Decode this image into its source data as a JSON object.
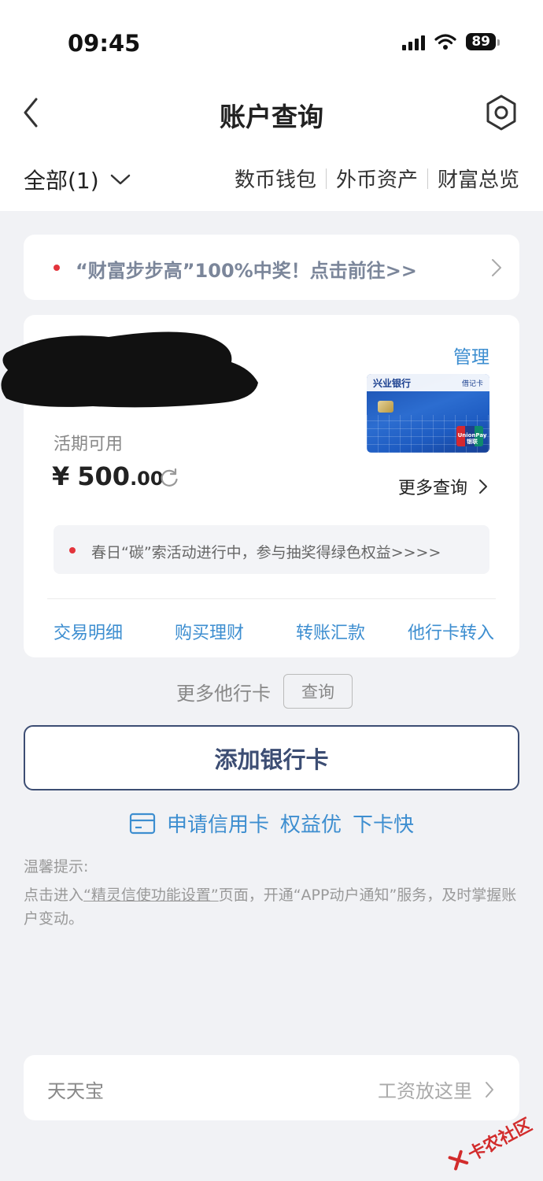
{
  "status_bar": {
    "time": "09:45",
    "battery": "89"
  },
  "nav": {
    "title": "账户查询"
  },
  "filter": {
    "all_label": "全部(1)",
    "links": [
      "数币钱包",
      "外币资产",
      "财富总览"
    ]
  },
  "banner": {
    "text": "“财富步步高”100%中奖！点击前往>>"
  },
  "account": {
    "manage_label": "管理",
    "bank_card": {
      "bank_name": "兴业银行",
      "card_type": "借记卡",
      "unionpay": "UnionPay 银联"
    },
    "available_label": "活期可用",
    "currency_symbol": "¥",
    "amount_int": "500",
    "amount_dec": ".00",
    "more_query_label": "更多查询",
    "notice": "春日“碳”索活动进行中，参与抽奖得绿色权益>>>>",
    "actions": [
      "交易明细",
      "购买理财",
      "转账汇款",
      "他行卡转入"
    ]
  },
  "more_cards": {
    "label": "更多他行卡",
    "button": "查询"
  },
  "add_card_label": "添加银行卡",
  "credit": {
    "parts": [
      "申请信用卡",
      "权益优",
      "下卡快"
    ]
  },
  "tips": {
    "title": "温馨提示:",
    "prefix": "点击进入",
    "link": "“精灵信使功能设置”",
    "suffix": "页面，开通“APP动户通知”服务，及时掌握账户变动。"
  },
  "tiantianbao": {
    "label": "天天宝",
    "right_label": "工资放这里"
  },
  "watermark": "卡农社区",
  "colors": {
    "accent": "#3d8ed0",
    "primary_button": "#3c4d73",
    "alert_dot": "#e3343c"
  }
}
